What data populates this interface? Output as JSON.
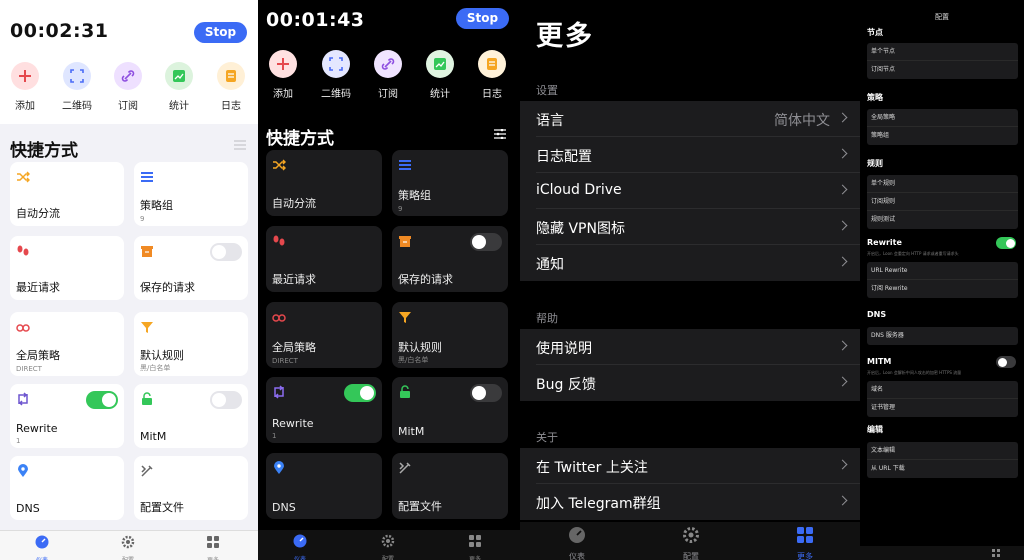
{
  "timer1": "00:02:31",
  "timer2": "00:01:43",
  "stop_label": "Stop",
  "actions": [
    "添加",
    "二维码",
    "订阅",
    "统计",
    "日志"
  ],
  "shortcuts_title": "快捷方式",
  "cards": {
    "auto_route": "自动分流",
    "policy_group": "策略组",
    "policy_group_count": "9",
    "recent_requests": "最近请求",
    "saved_requests": "保存的请求",
    "global_policy": "全局策略",
    "global_policy_sub": "DIRECT",
    "default_rule": "默认规则",
    "default_rule_sub": "黑/白名单",
    "rewrite": "Rewrite",
    "rewrite_count": "1",
    "mitm": "MitM",
    "dns": "DNS",
    "config_file": "配置文件"
  },
  "tabs": [
    "仪表",
    "配置",
    "更多"
  ],
  "more": {
    "title": "更多",
    "settings_label": "设置",
    "language": "语言",
    "language_value": "简体中文",
    "log_config": "日志配置",
    "icloud": "iCloud Drive",
    "hide_vpn": "隐藏 VPN图标",
    "notify": "通知",
    "help_label": "帮助",
    "manual": "使用说明",
    "bug": "Bug 反馈",
    "about_label": "关于",
    "twitter": "在 Twitter 上关注",
    "telegram": "加入 Telegram群组"
  },
  "config": {
    "title": "配置",
    "nodes": "节点",
    "single_node": "单个节点",
    "sub_node": "订阅节点",
    "policy": "策略",
    "global_policy": "全局策略",
    "policy_group": "策略组",
    "rules": "规则",
    "single_rule": "单个规则",
    "sub_rule": "订阅规则",
    "rule_test": "规则测试",
    "rewrite": "Rewrite",
    "rewrite_desc": "开启后，Loon 会重定向 HTTP 请求或者重写请求头",
    "url_rewrite": "URL Rewrite",
    "sub_rewrite": "订阅 Rewrite",
    "dns": "DNS",
    "dns_server": "DNS 服务器",
    "mitm": "MITM",
    "mitm_desc": "开启后，Loon 会解析中间人攻击的加密 HTTPS 流量",
    "domain": "域名",
    "cert": "证书管理",
    "edit": "编辑",
    "text_edit": "文本编辑",
    "url_download": "从 URL 下载"
  },
  "colors": {
    "accent": "#3b6bf5",
    "toggle_on": "#34c759"
  }
}
